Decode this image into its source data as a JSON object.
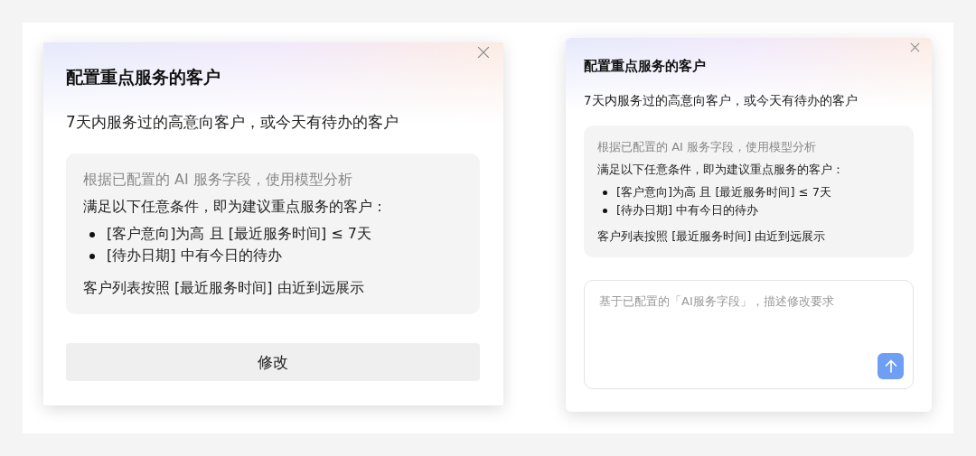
{
  "dialogs": [
    {
      "kind": "edit_button",
      "title": "配置重点服务的客户",
      "subtitle": "7天内服务过的高意向客户，或今天有待办的客户",
      "card": {
        "note": "根据已配置的 AI 服务字段，使用模型分析",
        "lead": "满足以下任意条件，即为建议重点服务的客户：",
        "conditions": [
          "[客户意向]为高 且 [最近服务时间] ≤ 7天",
          "[待办日期] 中有今日的待办"
        ],
        "sorting": "客户列表按照 [最近服务时间] 由近到远展示"
      },
      "button": "修改"
    },
    {
      "kind": "prompt_input",
      "title": "配置重点服务的客户",
      "subtitle": "7天内服务过的高意向客户，或今天有待办的客户",
      "card": {
        "note": "根据已配置的 AI 服务字段，使用模型分析",
        "lead": "满足以下任意条件，即为建议重点服务的客户：",
        "conditions": [
          "[客户意向]为高 且 [最近服务时间] ≤ 7天",
          "[待办日期] 中有今日的待办"
        ],
        "sorting": "客户列表按照 [最近服务时间] 由近到远展示"
      },
      "placeholder": "基于已配置的「AI服务字段」，描述修改要求"
    }
  ]
}
